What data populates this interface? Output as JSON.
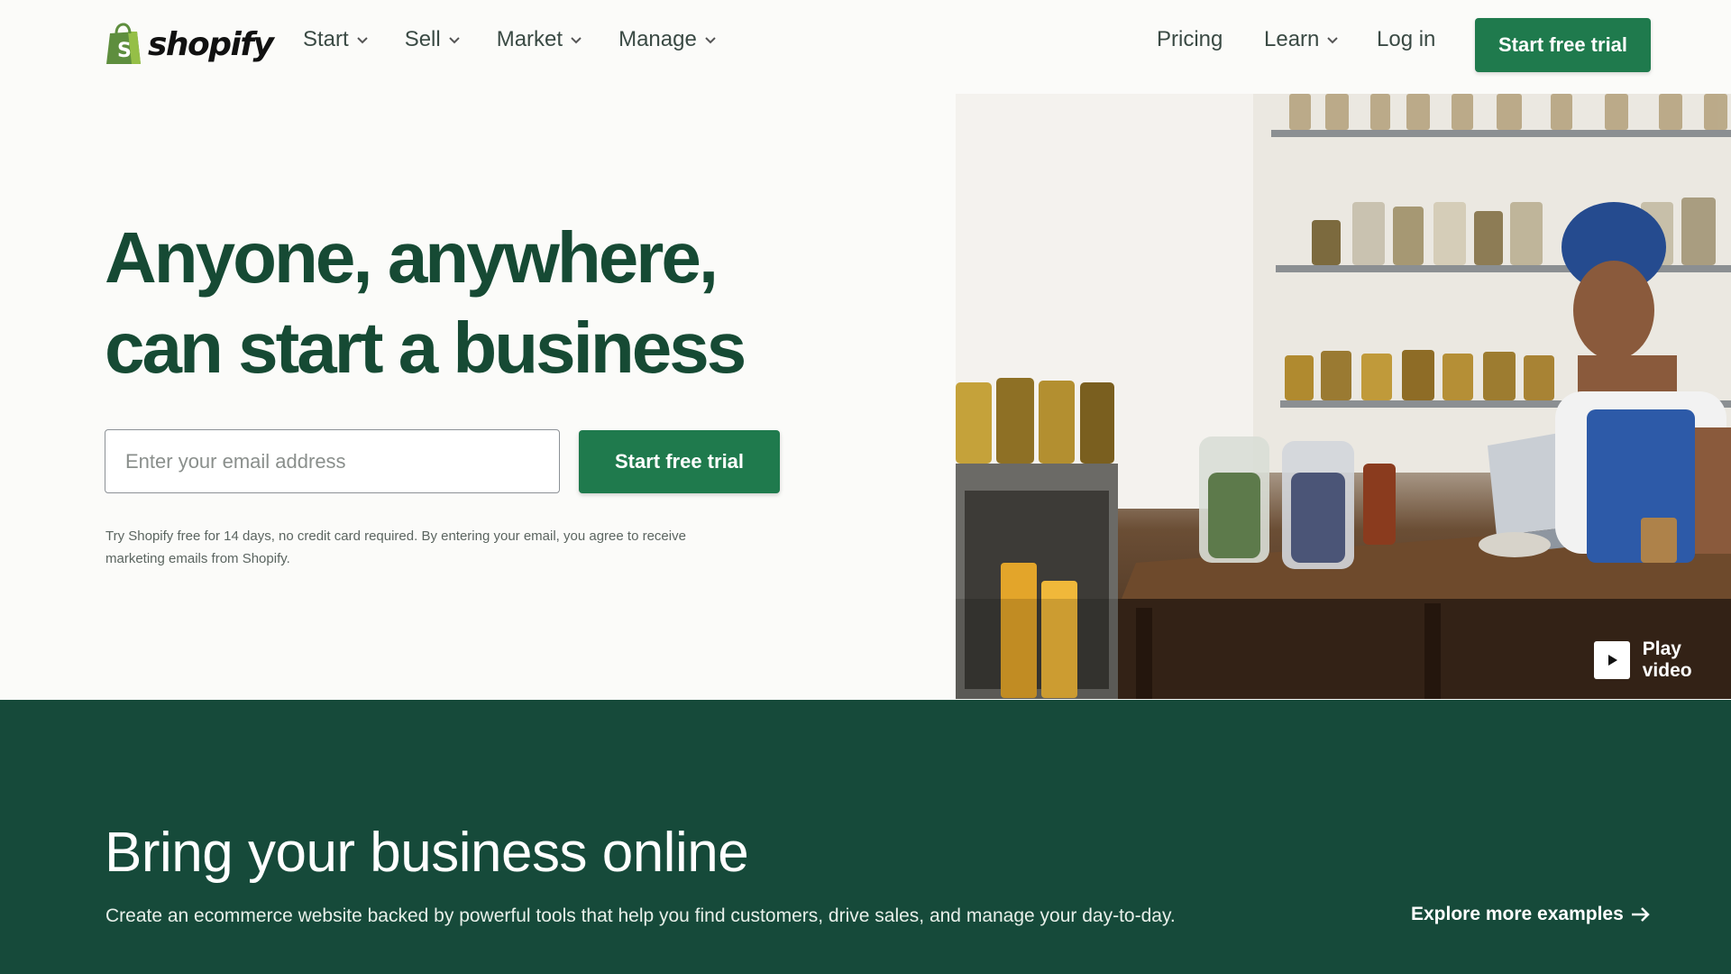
{
  "brand": {
    "name": "shopify",
    "accent": "#1f7a4d",
    "dark": "#164a3a"
  },
  "header": {
    "nav_left": [
      {
        "label": "Start"
      },
      {
        "label": "Sell"
      },
      {
        "label": "Market"
      },
      {
        "label": "Manage"
      }
    ],
    "pricing": "Pricing",
    "learn": "Learn",
    "login": "Log in",
    "cta": "Start free trial"
  },
  "hero": {
    "title_line1": "Anyone, anywhere,",
    "title_line2": "can start a business",
    "email_placeholder": "Enter your email address",
    "cta": "Start free trial",
    "disclaimer_line1": "Try Shopify free for 14 days, no credit card required. By entering your email, you agree to receive",
    "disclaimer_line2": "marketing emails from Shopify.",
    "play_label": "Play video"
  },
  "section2": {
    "title": "Bring your business online",
    "description": "Create an ecommerce website backed by powerful tools that help you find customers, drive sales, and manage your day-to-day.",
    "link": "Explore more examples"
  }
}
